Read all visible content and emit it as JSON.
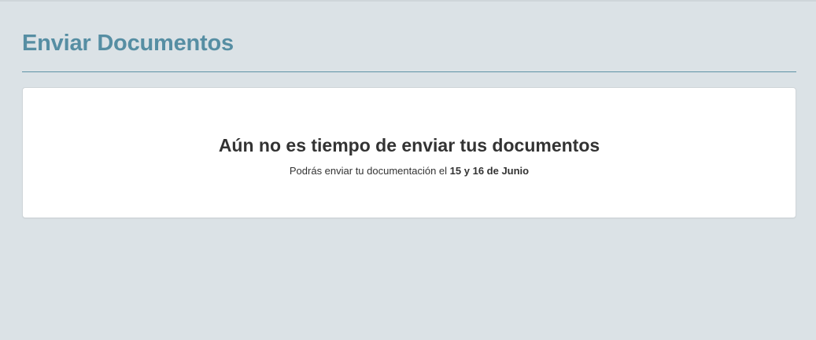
{
  "header": {
    "title": "Enviar Documentos"
  },
  "notice": {
    "heading": "Aún no es tiempo de enviar tus documentos",
    "text_prefix": "Podrás enviar tu documentación el ",
    "text_dates": "15 y 16 de Junio"
  },
  "colors": {
    "background": "#dbe2e6",
    "title": "#568ea3",
    "divider": "#5d93a6",
    "card": "#ffffff",
    "text": "#333333"
  }
}
